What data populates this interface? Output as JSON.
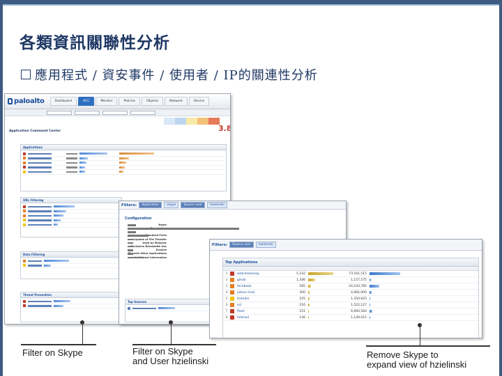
{
  "slide": {
    "title": "各類資訊關聯性分析",
    "bullet": "應用程式 / 資安事件 / 使用者 / IP的關連性分析"
  },
  "colors": {
    "title": "#1f3864",
    "accent": "#2f6fc0",
    "risk": "#c0392b"
  },
  "screenshot_acc": {
    "logo": "paloalto",
    "tabs": [
      "Dashboard",
      "ACC",
      "Monitor",
      "Policies",
      "Objects",
      "Network",
      "Device"
    ],
    "active_tab": "ACC",
    "risk_value": "3.8",
    "section_label": "Application Command Center",
    "panels": [
      "Applications",
      "URL Filtering",
      "Data Filtering",
      "Threat Prevention"
    ]
  },
  "screenshot_app": {
    "filters_label": "Filters:",
    "chips": [
      "Application",
      "skype",
      "Source user",
      "hzielinski"
    ],
    "config_title": "Configuration",
    "config_rows": [
      {
        "k": "Name"
      },
      {
        "k": "Description"
      },
      {
        "k": "Standard Ports"
      },
      {
        "k": "Capable of File Transfer"
      },
      {
        "k": "Used by Malware"
      },
      {
        "k": "Excessive Bandwidth Use"
      },
      {
        "k": "Evasive"
      },
      {
        "k": "Tunnels Other Applications"
      },
      {
        "k": "Additional Information"
      }
    ],
    "top_sources_title": "Top Sources"
  },
  "screenshot_user": {
    "filters_label": "Filters:",
    "chips": [
      "Source user",
      "hzielinski"
    ],
    "panel_title": "Top Applications",
    "rows": [
      {
        "rank": "1",
        "app": "web-browsing",
        "sessions": "5,142",
        "bytes": "73,161,515"
      },
      {
        "rank": "2",
        "app": "gmail",
        "sessions": "1,346",
        "bytes": "1,157,575"
      },
      {
        "rank": "3",
        "app": "facebook",
        "sessions": "585",
        "bytes": "24,220,785"
      },
      {
        "rank": "4",
        "app": "yahoo-mail",
        "sessions": "300",
        "bytes": "4,982,000"
      },
      {
        "rank": "5",
        "app": "linkedin",
        "sessions": "225",
        "bytes": "1,350,625"
      },
      {
        "rank": "6",
        "app": "ssl",
        "sessions": "216",
        "bytes": "1,522,127"
      },
      {
        "rank": "7",
        "app": "flash",
        "sessions": "151",
        "bytes": "6,960,583"
      },
      {
        "rank": "8",
        "app": "hotmail",
        "sessions": "136",
        "bytes": "1,149,015"
      }
    ]
  },
  "captions": {
    "c1": "Filter on Skype",
    "c2a": "Filter on Skype",
    "c2b": "and User hzielinski",
    "c3a": "Remove Skype to",
    "c3b": "expand view of hzielinski"
  }
}
